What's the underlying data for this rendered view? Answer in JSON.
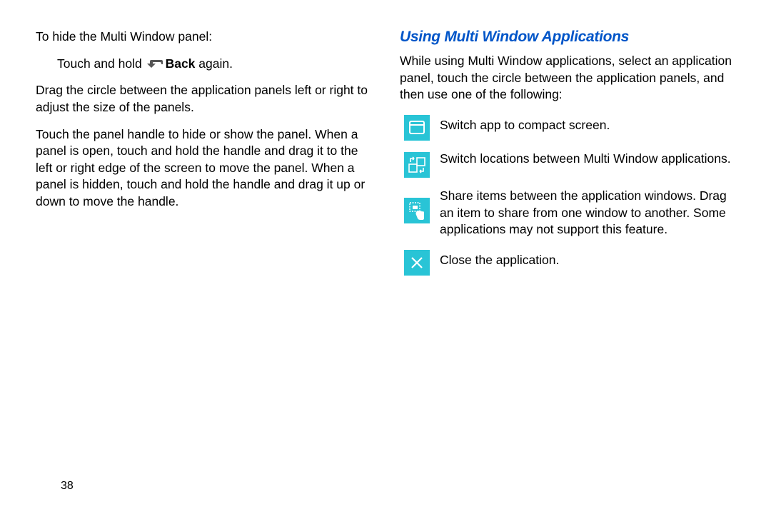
{
  "left": {
    "line1": "To hide the Multi Window panel:",
    "line2_pre": "Touch and hold ",
    "line2_bold": "Back",
    "line2_post": " again.",
    "para2": "Drag the circle between the application panels left or right to adjust the size of the panels.",
    "para3": "Touch the panel handle to hide or show the panel. When a panel is open, touch and hold the handle and drag it to the left or right edge of the screen to move the panel. When a panel is hidden, touch and hold the handle and drag it up or down to move the handle."
  },
  "right": {
    "heading": "Using Multi Window Applications",
    "intro": "While using Multi Window applications, select an application panel, touch the circle between the application panels, and then use one of the following:",
    "items": [
      {
        "text": "Switch app to compact screen."
      },
      {
        "text": "Switch locations between Multi Window applications."
      },
      {
        "text": "Share items between the application windows. Drag an item to share from one window to another. Some applications may not support this feature."
      },
      {
        "text": "Close the application."
      }
    ]
  },
  "pageNumber": "38"
}
